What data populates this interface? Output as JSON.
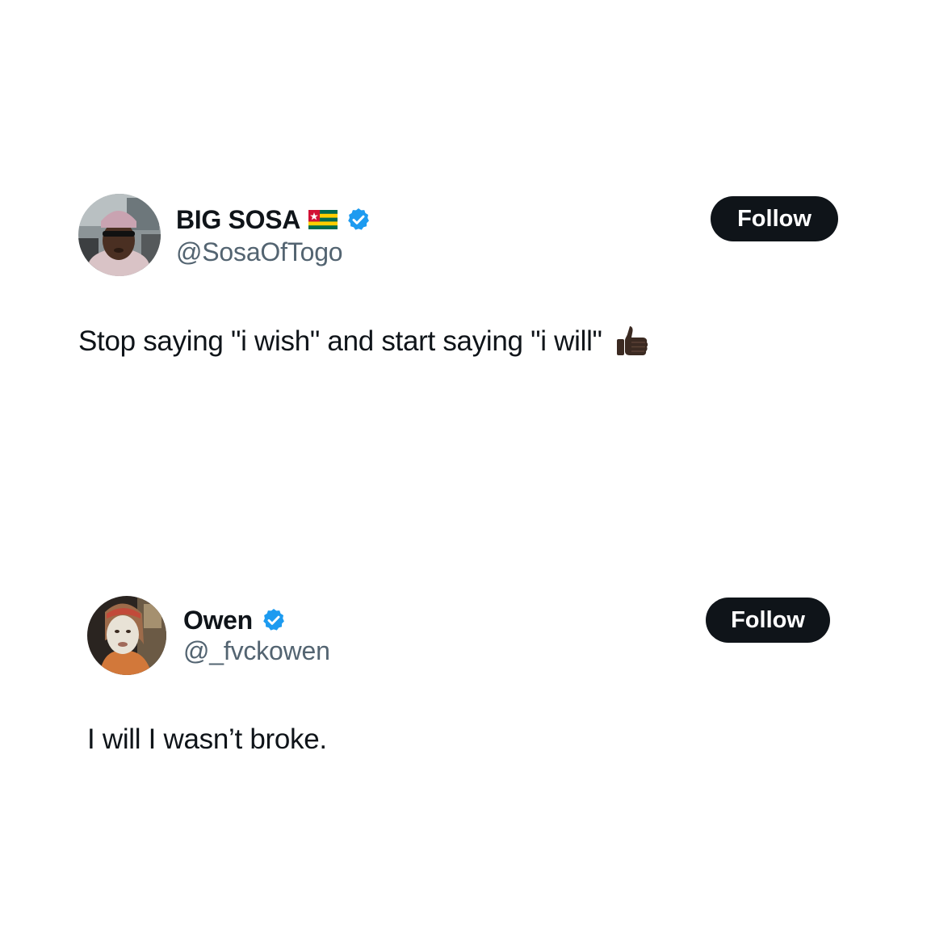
{
  "tweets": [
    {
      "display_name": "BIG SOSA",
      "flag_icon": "togo-flag-icon",
      "verified_icon": "verified-badge-icon",
      "handle": "@SosaOfTogo",
      "follow_label": "Follow",
      "text": "Stop saying \"i wish\" and start saying \"i will\"",
      "emoji_icon": "thumbs-up-icon"
    },
    {
      "display_name": "Owen",
      "verified_icon": "verified-badge-icon",
      "handle": "@_fvckowen",
      "follow_label": "Follow",
      "text": "I will I wasn’t broke."
    }
  ],
  "colors": {
    "text_primary": "#0f1419",
    "text_secondary": "#536471",
    "verified_blue": "#1d9bf0",
    "button_bg": "#0f1419",
    "button_text": "#ffffff"
  }
}
